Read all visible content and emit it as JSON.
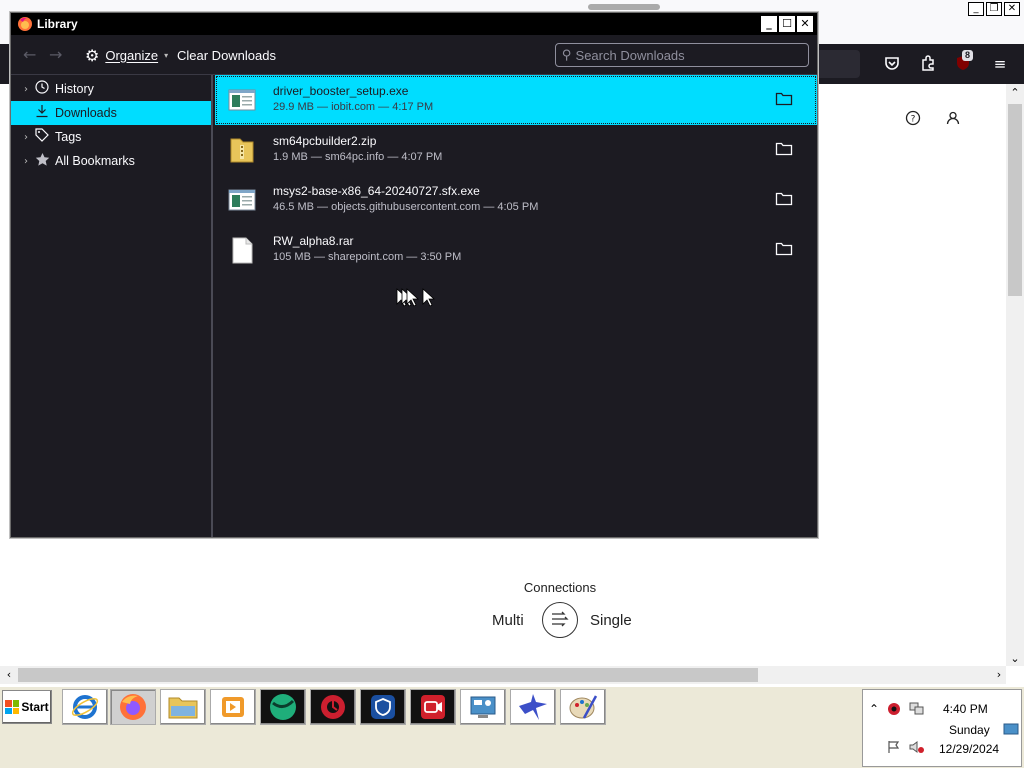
{
  "background_page": {
    "connections_label": "Connections",
    "multi_label": "Multi",
    "single_label": "Single",
    "addon_badge": "8"
  },
  "library": {
    "title": "Library",
    "toolbar": {
      "organize_label": "Organize",
      "clear_downloads_label": "Clear Downloads",
      "search_placeholder": "Search Downloads"
    },
    "sidebar": {
      "items": [
        {
          "label": "History",
          "icon": "clock-icon",
          "has_twisty": true,
          "selected": false
        },
        {
          "label": "Downloads",
          "icon": "download-icon",
          "has_twisty": false,
          "selected": true
        },
        {
          "label": "Tags",
          "icon": "tag-icon",
          "has_twisty": true,
          "selected": false
        },
        {
          "label": "All Bookmarks",
          "icon": "star-icon",
          "has_twisty": true,
          "selected": false
        }
      ]
    },
    "downloads": [
      {
        "name": "driver_booster_setup.exe",
        "meta": "29.9 MB — iobit.com — 4:17 PM",
        "icon": "exe-file-icon",
        "selected": true
      },
      {
        "name": "sm64pcbuilder2.zip",
        "meta": "1.9 MB — sm64pc.info — 4:07 PM",
        "icon": "zip-file-icon",
        "selected": false
      },
      {
        "name": "msys2-base-x86_64-20240727.sfx.exe",
        "meta": "46.5 MB — objects.githubusercontent.com — 4:05 PM",
        "icon": "exe-file-icon",
        "selected": false
      },
      {
        "name": "RW_alpha8.rar",
        "meta": "105 MB — sharepoint.com — 3:50 PM",
        "icon": "blank-file-icon",
        "selected": false
      }
    ],
    "colors": {
      "selection": "#00ddff",
      "background": "#1c1b22",
      "text": "#fbfbfe"
    }
  },
  "taskbar": {
    "start_label": "Start",
    "apps": [
      {
        "name": "internet-explorer",
        "color": "#1e73d0"
      },
      {
        "name": "firefox",
        "color": "#ff7139"
      },
      {
        "name": "file-explorer",
        "color": "#e8c55a"
      },
      {
        "name": "media-player",
        "color": "#f09a2a"
      },
      {
        "name": "globe-app",
        "color": "#1fae7a"
      },
      {
        "name": "iobit-driver-booster",
        "color": "#cc1f2f"
      },
      {
        "name": "shield-app",
        "color": "#1a4fa0"
      },
      {
        "name": "screen-recorder",
        "color": "#d0202b"
      },
      {
        "name": "control-panel",
        "color": "#4a90c8"
      },
      {
        "name": "bird-app",
        "color": "#3c4fc8"
      },
      {
        "name": "paint-app",
        "color": "#6aa84f"
      }
    ],
    "clock": {
      "time": "4:40 PM",
      "day": "Sunday",
      "date": "12/29/2024"
    }
  }
}
